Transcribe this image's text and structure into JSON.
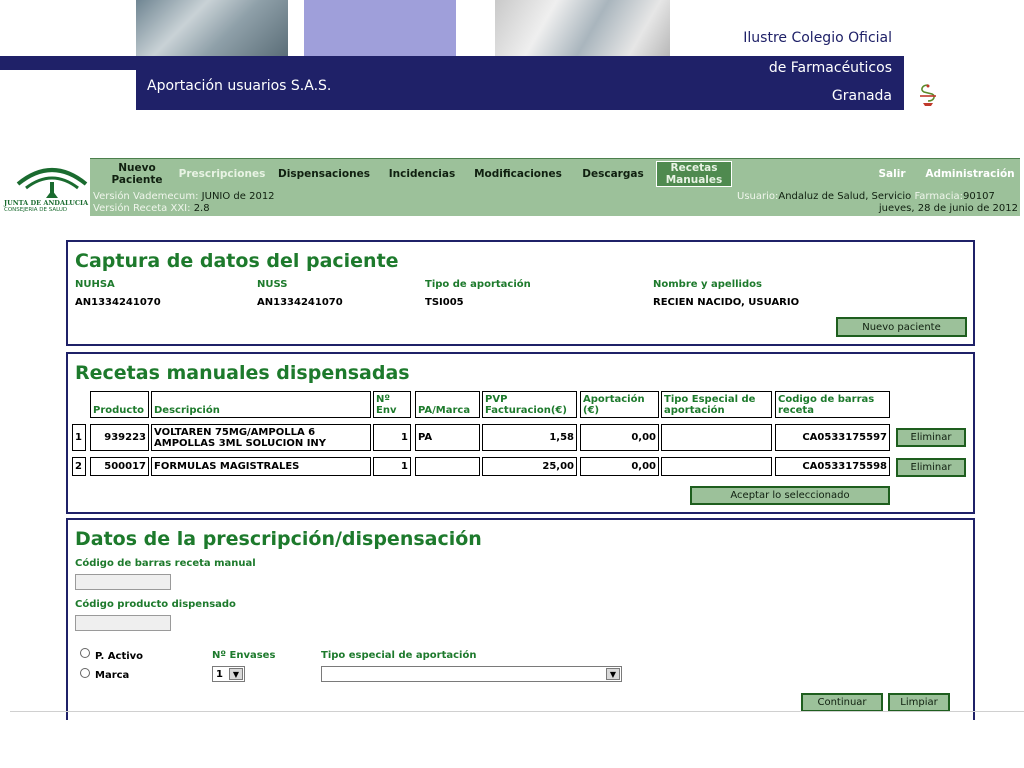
{
  "header": {
    "colegio_line1": "Ilustre Colegio Oficial",
    "colegio_line2": "de Farmacéuticos",
    "colegio_line3": "Granada",
    "app_title": "Aportación usuarios S.A.S."
  },
  "logo": {
    "junta_text1": "JUNTA DE ANDALUCIA",
    "junta_text2": "CONSEJERIA DE SALUD"
  },
  "nav": {
    "items": [
      {
        "label": "Nuevo Paciente"
      },
      {
        "label": "Prescripciones"
      },
      {
        "label": "Dispensaciones"
      },
      {
        "label": "Incidencias"
      },
      {
        "label": "Modificaciones"
      },
      {
        "label": "Descargas"
      },
      {
        "label": "Recetas Manuales"
      }
    ],
    "salir": "Salir",
    "admin": "Administración"
  },
  "info": {
    "vademecum_label": "Versión Vademecum:",
    "vademecum_value": "JUNIO de 2012",
    "receta_label": "Versión Receta XXI:",
    "receta_value": "2.8",
    "usuario_label": "Usuario:",
    "usuario_value": "Andaluz de Salud, Servicio",
    "farmacia_label": "Farmacia:",
    "farmacia_value": "90107",
    "date": "jueves, 28 de junio de 2012"
  },
  "patient": {
    "title": "Captura de datos del paciente",
    "labels": {
      "nuhsa": "NUHSA",
      "nuss": "NUSS",
      "tipo": "Tipo de aportación",
      "nombre": "Nombre y apellidos"
    },
    "values": {
      "nuhsa": "AN1334241070",
      "nuss": "AN1334241070",
      "tipo": "TSI005",
      "nombre": "RECIEN NACIDO, USUARIO"
    },
    "new_button": "Nuevo paciente"
  },
  "recetas": {
    "title": "Recetas manuales dispensadas",
    "headers": [
      "Producto",
      "Descripción",
      "Nº Env",
      "PA/Marca",
      "PVP Facturacion(€)",
      "Aportación (€)",
      "Tipo Especial de aportación",
      "Codigo de barras receta"
    ],
    "rows": [
      {
        "n": "1",
        "producto": "939223",
        "descripcion": "VOLTAREN 75MG/AMPOLLA 6 AMPOLLAS 3ML SOLUCION INY",
        "env": "1",
        "pa": "PA",
        "pvp": "1,58",
        "aportacion": "0,00",
        "tipo": "",
        "codigo": "CA0533175597",
        "action": "Eliminar"
      },
      {
        "n": "2",
        "producto": "500017",
        "descripcion": "FORMULAS MAGISTRALES",
        "env": "1",
        "pa": "",
        "pvp": "25,00",
        "aportacion": "0,00",
        "tipo": "",
        "codigo": "CA0533175598",
        "action": "Eliminar"
      }
    ],
    "accept_button": "Aceptar lo seleccionado"
  },
  "prescripcion": {
    "title": "Datos de la prescripción/dispensación",
    "codigo_barras_label": "Código de barras receta manual",
    "codigo_barras_value": "",
    "codigo_producto_label": "Código producto dispensado",
    "codigo_producto_value": "",
    "radio_activo": "P. Activo",
    "radio_marca": "Marca",
    "envases_label": "Nº Envases",
    "envases_value": "1",
    "tipo_label": "Tipo especial de aportación",
    "tipo_value": "",
    "continuar": "Continuar",
    "limpiar": "Limpiar"
  }
}
